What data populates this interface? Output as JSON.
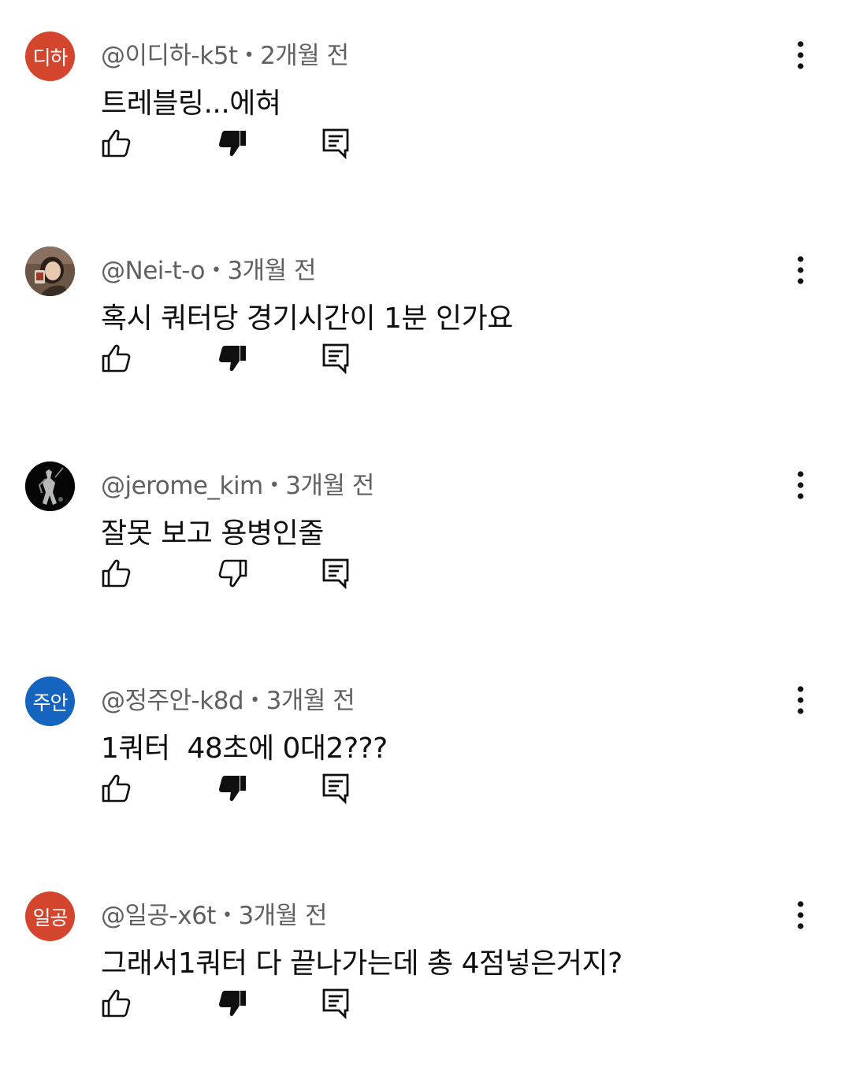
{
  "comments": [
    {
      "avatar_text": "디하",
      "avatar_color": "#d3452d",
      "avatar_type": "text",
      "username": "@이디하-k5t",
      "time": "2개월 전",
      "text": "트레블링...에혀",
      "disliked": true
    },
    {
      "avatar_text": "",
      "avatar_color": "#5a4a3a",
      "avatar_type": "photo",
      "username": "@Nei-t-o",
      "time": "3개월 전",
      "text": "혹시 쿼터당 경기시간이 1분 인가요",
      "disliked": true
    },
    {
      "avatar_text": "",
      "avatar_color": "#0a0a0a",
      "avatar_type": "photo-dark",
      "username": "@jerome_kim",
      "time": "3개월 전",
      "text": "잘못 보고 용병인줄",
      "disliked": false
    },
    {
      "avatar_text": "주안",
      "avatar_color": "#1565c0",
      "avatar_type": "text",
      "username": "@정주안-k8d",
      "time": "3개월 전",
      "text": "1쿼터  48초에 0대2???",
      "disliked": true
    },
    {
      "avatar_text": "일공",
      "avatar_color": "#d3452d",
      "avatar_type": "text",
      "username": "@일공-x6t",
      "time": "3개월 전",
      "text": "그래서1쿼터 다 끝나가는데 총 4점넣은거지?",
      "disliked": true
    }
  ],
  "separator": "•",
  "icons": {
    "like": "thumb-up-outline-icon",
    "dislike": "thumb-down-icon",
    "reply": "reply-comment-icon",
    "more": "more-vert-icon"
  }
}
